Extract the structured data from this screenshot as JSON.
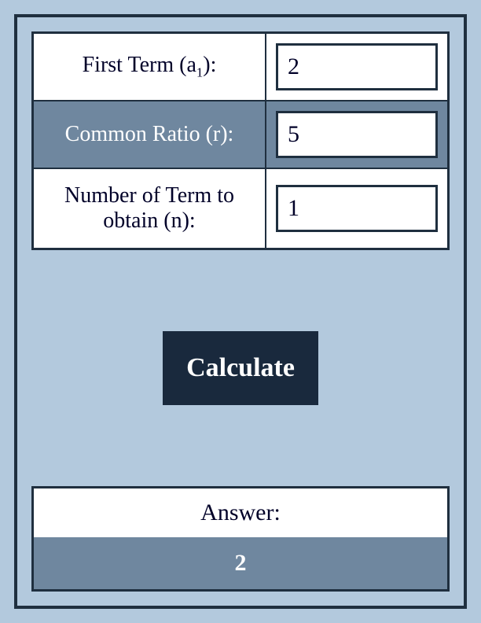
{
  "form": {
    "firstTerm": {
      "labelPrefix": "First Term (a",
      "labelSub": "1",
      "labelSuffix": "):",
      "value": "2"
    },
    "commonRatio": {
      "label": "Common Ratio (r):",
      "value": "5"
    },
    "numTerms": {
      "label": "Number of Term to obtain (n):",
      "value": "1"
    }
  },
  "button": {
    "calculate": "Calculate"
  },
  "answer": {
    "label": "Answer:",
    "value": "2"
  }
}
